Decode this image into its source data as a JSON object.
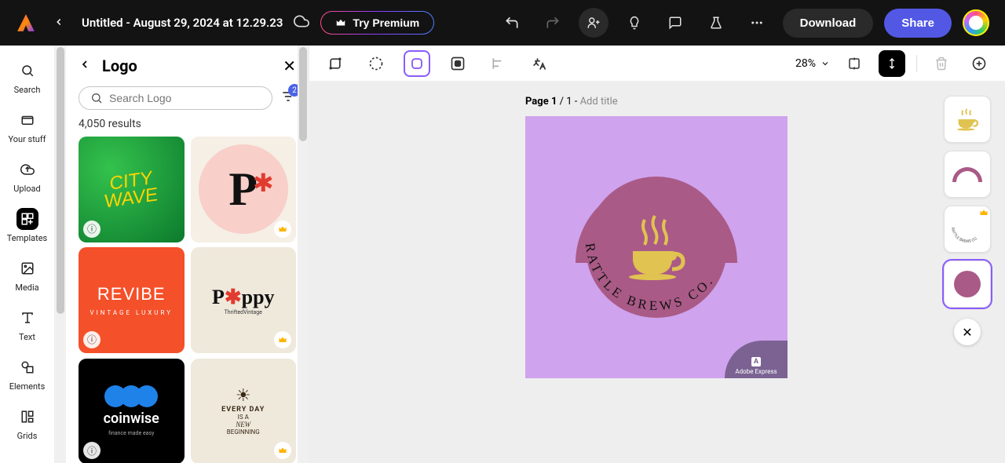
{
  "header": {
    "title": "Untitled - August 29, 2024 at 12.29.23",
    "premium": "Try Premium",
    "download": "Download",
    "share": "Share"
  },
  "rail": {
    "search": "Search",
    "your_stuff": "Your stuff",
    "upload": "Upload",
    "templates": "Templates",
    "media": "Media",
    "text": "Text",
    "elements": "Elements",
    "grids": "Grids"
  },
  "panel": {
    "title": "Logo",
    "search_placeholder": "Search Logo",
    "filter_count": "2",
    "results": "4,050 results",
    "templates": {
      "citywave": "CITY\nWAVE",
      "p_letter": "P",
      "revibe_title": "REVIBE",
      "revibe_sub": "VINTAGE LUXURY",
      "poppy_title": "P✱ppy",
      "poppy_sub": "ThriftedVintage",
      "coinwise_title": "coinwise",
      "coinwise_sub": "finance made easy",
      "everyday_l1": "EVERY DAY",
      "everyday_l2": "IS A",
      "everyday_l3": "NEW",
      "everyday_l4": "BEGINNING"
    }
  },
  "canvas": {
    "zoom": "28%",
    "page_prefix": "Page 1 ",
    "page_mid": "/ 1 - ",
    "page_add": "Add title",
    "ring_text": "RATTLE BREWS CO.",
    "watermark": "Adobe Express",
    "watermark_letter": "A"
  },
  "layers": {
    "text_label": "RATTLE BREWS CO."
  }
}
